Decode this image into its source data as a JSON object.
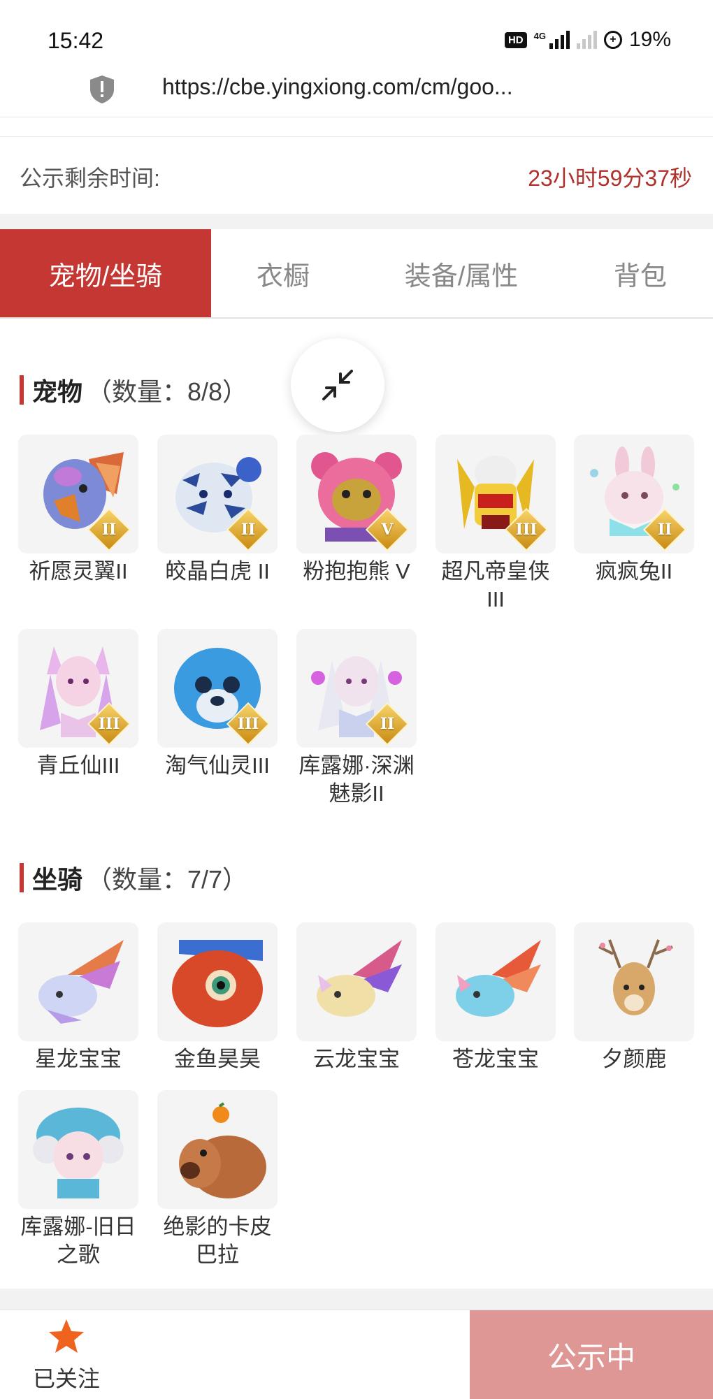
{
  "status_bar": {
    "time": "15:42",
    "hd_label": "HD",
    "network_label": "4G",
    "battery": "19%"
  },
  "browser": {
    "url": "https://cbe.yingxiong.com/cm/goo...",
    "security_icon": "shield-warning-icon"
  },
  "countdown": {
    "label": "公示剩余时间:",
    "value": "23小时59分37秒",
    "color": "#b0312b"
  },
  "tabs": [
    {
      "label": "宠物/坐骑",
      "active": true
    },
    {
      "label": "衣橱",
      "active": false
    },
    {
      "label": "装备/属性",
      "active": false
    },
    {
      "label": "背包",
      "active": false
    }
  ],
  "pets": {
    "title": "宠物",
    "count": "（数量：8/8）",
    "items": [
      {
        "name": "祈愿灵翼II",
        "grade": "II"
      },
      {
        "name": "皎晶白虎 II",
        "grade": "II"
      },
      {
        "name": "粉抱抱熊 V",
        "grade": "V"
      },
      {
        "name": "超凡帝皇侠III",
        "grade": "III"
      },
      {
        "name": "疯疯兔II",
        "grade": "II"
      },
      {
        "name": "青丘仙III",
        "grade": "III"
      },
      {
        "name": "淘气仙灵III",
        "grade": "III"
      },
      {
        "name": "库露娜·深渊魅影II",
        "grade": "II"
      }
    ]
  },
  "mounts": {
    "title": "坐骑",
    "count": "（数量：7/7）",
    "items": [
      {
        "name": "星龙宝宝"
      },
      {
        "name": "金鱼昊昊"
      },
      {
        "name": "云龙宝宝"
      },
      {
        "name": "苍龙宝宝"
      },
      {
        "name": "夕颜鹿"
      },
      {
        "name": "库露娜-旧日之歌"
      },
      {
        "name": "绝影的卡皮巴拉"
      }
    ]
  },
  "collapse_icon": "collapse-arrows-icon",
  "bottom": {
    "follow_label": "已关注",
    "follow_icon": "star-icon",
    "status_label": "公示中",
    "accent": "#c43732"
  }
}
